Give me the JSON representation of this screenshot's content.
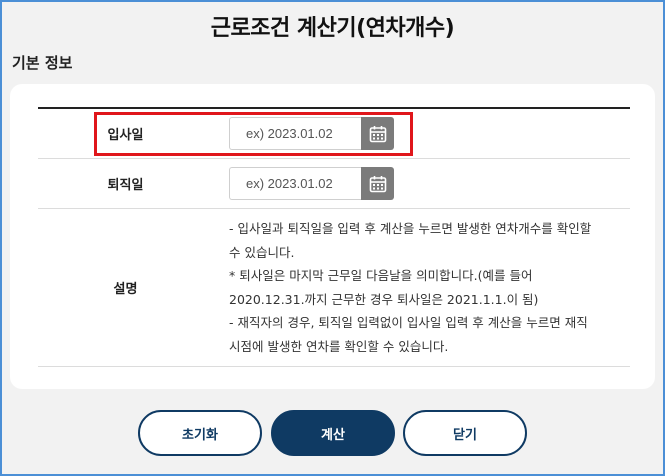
{
  "header": {
    "title": "근로조건 계산기(연차개수)"
  },
  "section": {
    "title": "기본 정보"
  },
  "form": {
    "hire_date": {
      "label": "입사일",
      "placeholder": "ex) 2023.01.02",
      "value": ""
    },
    "leave_date": {
      "label": "퇴직일",
      "placeholder": "ex) 2023.01.02",
      "value": ""
    },
    "description": {
      "label": "설명",
      "lines": [
        "- 입사일과 퇴직일을 입력 후 계산을 누르면 발생한 연차개수를 확인할 수 있습니다.",
        "* 퇴사일은 마지막 근무일 다음날을 의미합니다.(예를 들어 2020.12.31.까지 근무한 경우 퇴사일은 2021.1.1.이 됨)",
        "- 재직자의 경우, 퇴직일 입력없이 입사일 입력 후 계산을 누르면 재직시점에 발생한 연차를 확인할 수 있습니다."
      ]
    }
  },
  "icons": {
    "calendar": "calendar-icon"
  },
  "colors": {
    "primary": "#0f3a63",
    "highlight": "#e0161b",
    "calendar_button": "#7b7b7b"
  },
  "buttons": {
    "reset": "초기화",
    "calculate": "계산",
    "close": "닫기"
  }
}
